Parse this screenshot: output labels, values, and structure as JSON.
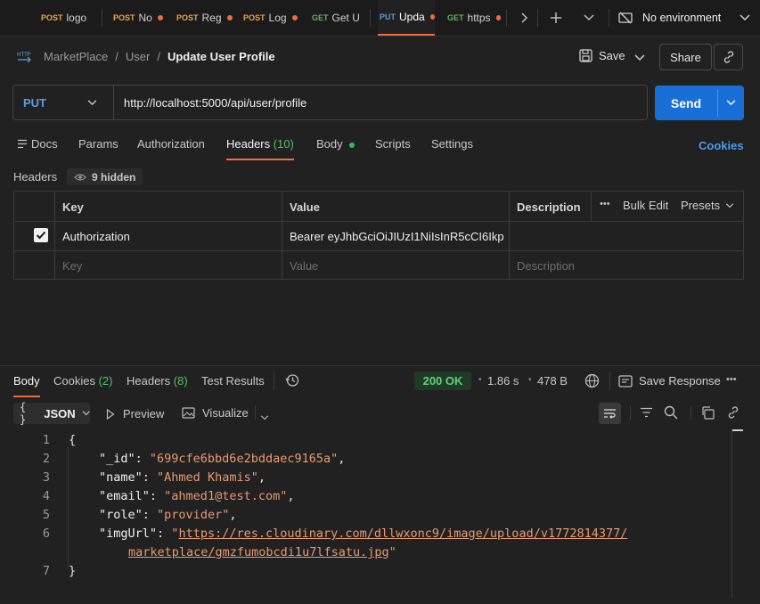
{
  "tabs": [
    {
      "method": "POST",
      "title": "logo",
      "dirty": false
    },
    {
      "method": "POST",
      "title": "No",
      "dirty": true
    },
    {
      "method": "POST",
      "title": "Reg",
      "dirty": true
    },
    {
      "method": "POST",
      "title": "Log",
      "dirty": true
    },
    {
      "method": "GET",
      "title": "Get U",
      "dirty": false
    },
    {
      "method": "PUT",
      "title": "Upda",
      "dirty": true,
      "active": true
    },
    {
      "method": "GET",
      "title": "https",
      "dirty": true
    }
  ],
  "environment": "No environment",
  "breadcrumb": {
    "root": "MarketPlace",
    "folder": "User",
    "current": "Update User Profile",
    "sep": "/"
  },
  "toolbar": {
    "save_label": "Save",
    "share_label": "Share"
  },
  "request": {
    "method": "PUT",
    "url": "http://localhost:5000/api/user/profile",
    "send_label": "Send"
  },
  "request_tabs": {
    "docs": "Docs",
    "params": "Params",
    "authorization": "Authorization",
    "headers": "Headers",
    "headers_count": "(10)",
    "body": "Body",
    "scripts": "Scripts",
    "settings": "Settings",
    "cookies": "Cookies"
  },
  "headers_section": {
    "title": "Headers",
    "hidden": "9 hidden"
  },
  "headers_table": {
    "columns": {
      "key": "Key",
      "value": "Value",
      "description": "Description",
      "bulk_edit": "Bulk Edit",
      "presets": "Presets",
      "more": "•••"
    },
    "rows": [
      {
        "key": "Authorization",
        "value": "Bearer eyJhbGciOiJIUzI1NiIsInR5cCI6Ikp...",
        "checked": true
      }
    ],
    "placeholder": {
      "key": "Key",
      "value": "Value",
      "description": "Description"
    }
  },
  "response": {
    "tabs": {
      "body": "Body",
      "cookies": "Cookies",
      "cookies_count": "(2)",
      "headers": "Headers",
      "headers_count": "(8)",
      "tests": "Test Results"
    },
    "status": "200 OK",
    "time": "1.86 s",
    "size": "478 B",
    "save": "Save Response",
    "more": "•••",
    "format": "JSON",
    "format_icon": "{ }",
    "preview": "Preview",
    "visualize": "Visualize"
  },
  "code": {
    "lines": [
      {
        "n": "1",
        "text": "{"
      },
      {
        "n": "2",
        "key": "\"_id\"",
        "val": "\"699cfe6bbd6e2bddaec9165a\""
      },
      {
        "n": "3",
        "key": "\"name\"",
        "val": "\"Ahmed Khamis\""
      },
      {
        "n": "4",
        "key": "\"email\"",
        "val": "\"ahmed1@test.com\""
      },
      {
        "n": "5",
        "key": "\"role\"",
        "val": "\"provider\""
      },
      {
        "n": "6",
        "key": "\"imgUrl\"",
        "val_a": "https://res.cloudinary.com/dllwxonc9/image/upload/v1772814377/",
        "val_b": "marketplace/gmzfumobcdi1u7lfsatu.jpg"
      },
      {
        "n": "7",
        "text": "}"
      }
    ]
  },
  "colors": {
    "accent": "#f26b3a",
    "send": "#1a6fd6",
    "status_ok": "#55c267",
    "string": "#e89a72"
  }
}
